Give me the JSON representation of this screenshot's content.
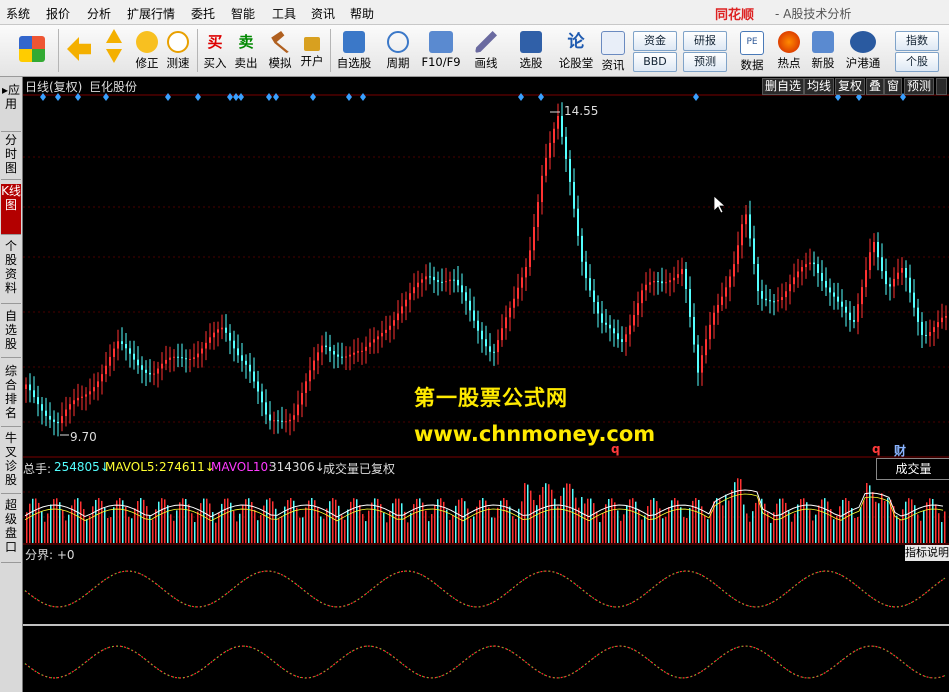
{
  "menu": [
    "系统",
    "报价",
    "分析",
    "扩展行情",
    "委托",
    "智能",
    "工具",
    "资讯",
    "帮助"
  ],
  "brand": {
    "name": "同花顺",
    "subtitle": "- A股技术分析"
  },
  "toolbar": {
    "items": [
      "修正",
      "测速",
      "买入",
      "卖出",
      "模拟",
      "开户",
      "自选股",
      "周期",
      "F10/F9",
      "画线",
      "选股",
      "论股堂",
      "资讯",
      "数据",
      "热点",
      "新股",
      "沪港通"
    ],
    "pills": [
      "资金",
      "BBD",
      "研报",
      "预测",
      "指数",
      "个股"
    ]
  },
  "sidebar": [
    "应用",
    "分时图",
    "K线图",
    "个股资料",
    "自选股",
    "综合排名",
    "牛叉诊股",
    "超级盘口"
  ],
  "chart_header": {
    "label": "日线(复权)",
    "stock": "巨化股份"
  },
  "right_buttons": [
    "删自选",
    "均线",
    "复权",
    "叠",
    "窗",
    "预测"
  ],
  "price_labels": {
    "high": "14.55",
    "low": "9.70"
  },
  "volume_header": {
    "total_label": "总手:",
    "total": "254805↓",
    "ma5_label": "MAVOL5:",
    "ma5": "274611↓",
    "ma10_label": "MAVOL10:",
    "ma10": "314306↓",
    "note": "成交量已复权"
  },
  "markers": {
    "q1": "q",
    "q2": "q",
    "fin": "财"
  },
  "volume_tag": "成交量",
  "indicator_header": "分界: +0",
  "indicator_button": "指标说明",
  "watermark": {
    "line1": "第一股票公式网",
    "line2": "www.chnmoney.com"
  },
  "colors": {
    "up": "#ff3232",
    "down": "#54ffff",
    "accent": "#b30000",
    "watermark": "#ffea00"
  }
}
